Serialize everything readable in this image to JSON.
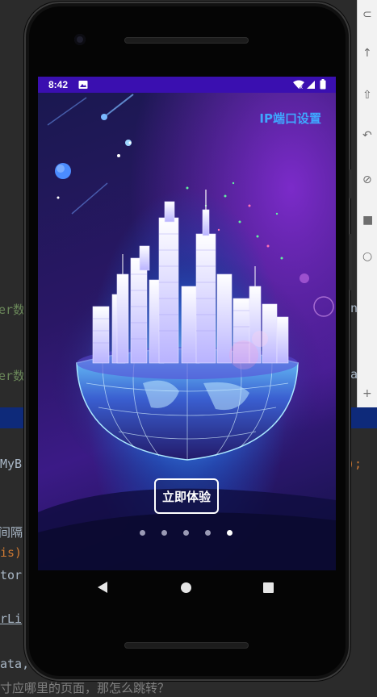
{
  "status_bar": {
    "time": "8:42",
    "icons": [
      "image-icon",
      "wifi-icon",
      "signal-icon",
      "battery-icon"
    ]
  },
  "app": {
    "ip_settings_label": "IP端口设置",
    "cta_label": "立即体验",
    "pager": {
      "count": 5,
      "active_index": 4
    }
  },
  "nav_bar": {
    "icons": [
      "back-icon",
      "home-icon",
      "recents-icon"
    ]
  },
  "ide_fragments": {
    "left": [
      {
        "text": "er数",
        "color": "#6a8759"
      },
      {
        "text": "er数",
        "color": "#6a8759"
      },
      {
        "text": "MyB",
        "color": "#a9b7c6"
      },
      {
        "text": "间隔",
        "color": "#a9b7c6"
      },
      {
        "text": "is)",
        "color": "#cc7832"
      },
      {
        "text": "tor",
        "color": "#a9b7c6"
      },
      {
        "text": "rLi",
        "color": "#a9b7c6"
      },
      {
        "text": "ata,",
        "color": "#a9b7c6"
      },
      {
        "text": "寸应哪里的页面，那怎么跳转？",
        "color": "#808080"
      }
    ],
    "right": [
      {
        "text": "n",
        "color": "#a9b7c6"
      },
      {
        "text": "a",
        "color": "#a9b7c6"
      },
      {
        "text": ");",
        "color": "#cc7832"
      }
    ]
  }
}
